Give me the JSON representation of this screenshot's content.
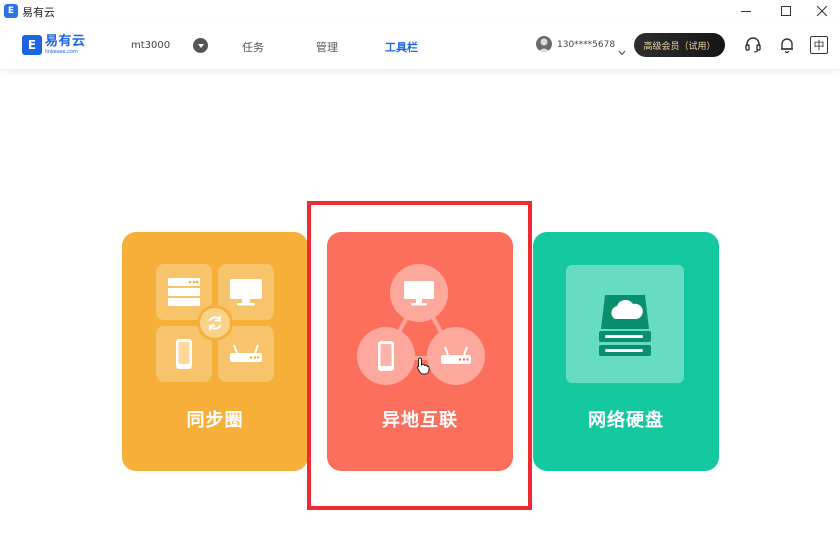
{
  "window": {
    "title": "易有云",
    "app_icon_letter": "E"
  },
  "nav": {
    "logo_name": "易有云",
    "logo_url": "linkease.com",
    "device_name": "mt3000",
    "items": [
      {
        "label": "任务",
        "active": false
      },
      {
        "label": "管理",
        "active": false
      },
      {
        "label": "工具栏",
        "active": true
      }
    ],
    "account": "130****5678",
    "vip_label": "高级会员（试用）",
    "language_label": "中"
  },
  "cards": [
    {
      "label": "同步圈",
      "color": "#f6b03a"
    },
    {
      "label": "异地互联",
      "color": "#fc6f5d"
    },
    {
      "label": "网络硬盘",
      "color": "#14c9a0"
    }
  ],
  "colors": {
    "accent": "#1d64e0",
    "highlight": "#ee2a32"
  }
}
